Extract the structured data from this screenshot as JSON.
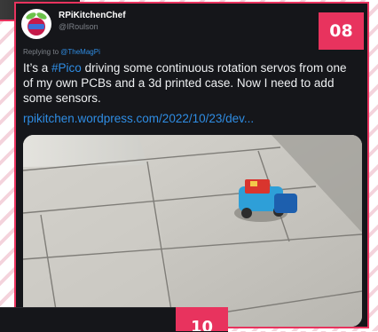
{
  "previous_card": {},
  "tweet": {
    "display_name": "RPiKitchenChef",
    "handle": "@IRoulson",
    "replying_prefix": "Replying to",
    "replying_to": "@TheMagPi",
    "text_before_tag": "It’s a ",
    "hashtag": "#Pico",
    "text_after_tag": " driving some continuous rotation servos from one of my own PCBs and a 3d printed case. Now I need to add some sensors.",
    "link": "rpikitchen.wordpress.com/2022/10/23/dev...",
    "media_description": "photo-robot-on-tiled-floor"
  },
  "badge": {
    "number": "08"
  },
  "next_card": {
    "badge_number": "10"
  },
  "colors": {
    "accent": "#e8335e",
    "link": "#2f8de4",
    "card_bg": "#15161a"
  }
}
